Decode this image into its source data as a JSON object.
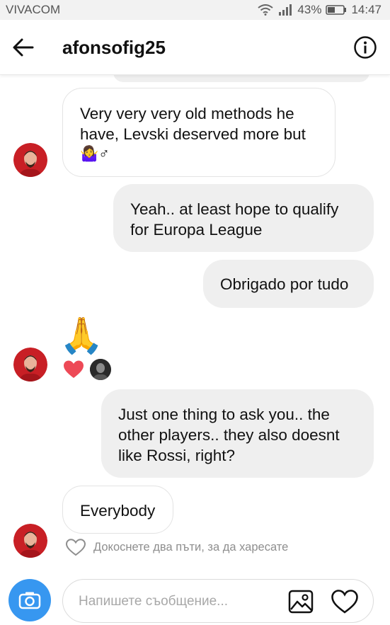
{
  "status_bar": {
    "carrier": "VIVACOM",
    "battery_percent": "43%",
    "time": "14:47"
  },
  "header": {
    "back_icon": "arrow-left-icon",
    "username": "afonsofig25",
    "info_icon": "info-circle-icon"
  },
  "messages": [
    {
      "direction": "incoming",
      "lines": [
        "Very very very old methods he",
        "have, Levski deserved more but"
      ],
      "emoji": "🤷‍♀️",
      "emoji_suffix": "♂"
    },
    {
      "direction": "outgoing",
      "lines": [
        "Yeah.. at least hope to qualify",
        "for Europa League"
      ]
    },
    {
      "direction": "outgoing",
      "lines": [
        "Obrigado por tudo"
      ]
    },
    {
      "direction": "incoming",
      "emoji": "🙏",
      "reactions": [
        "heart",
        "avatar"
      ]
    },
    {
      "direction": "outgoing",
      "lines": [
        "Just one thing to ask you.. the",
        "other players.. they also doesnt",
        "like Rossi, right?"
      ]
    },
    {
      "direction": "incoming",
      "lines": [
        "Everybody"
      ]
    }
  ],
  "like_hint": "Докоснете два пъти, за да харесате",
  "composer": {
    "placeholder": "Напишете съобщение...",
    "camera_icon": "camera-icon",
    "gallery_icon": "gallery-icon",
    "heart_icon": "heart-icon"
  },
  "colors": {
    "accent": "#3797f0",
    "incoming_bg": "#ffffff",
    "outgoing_bg": "#efefef",
    "reaction_heart": "#ed4956"
  }
}
